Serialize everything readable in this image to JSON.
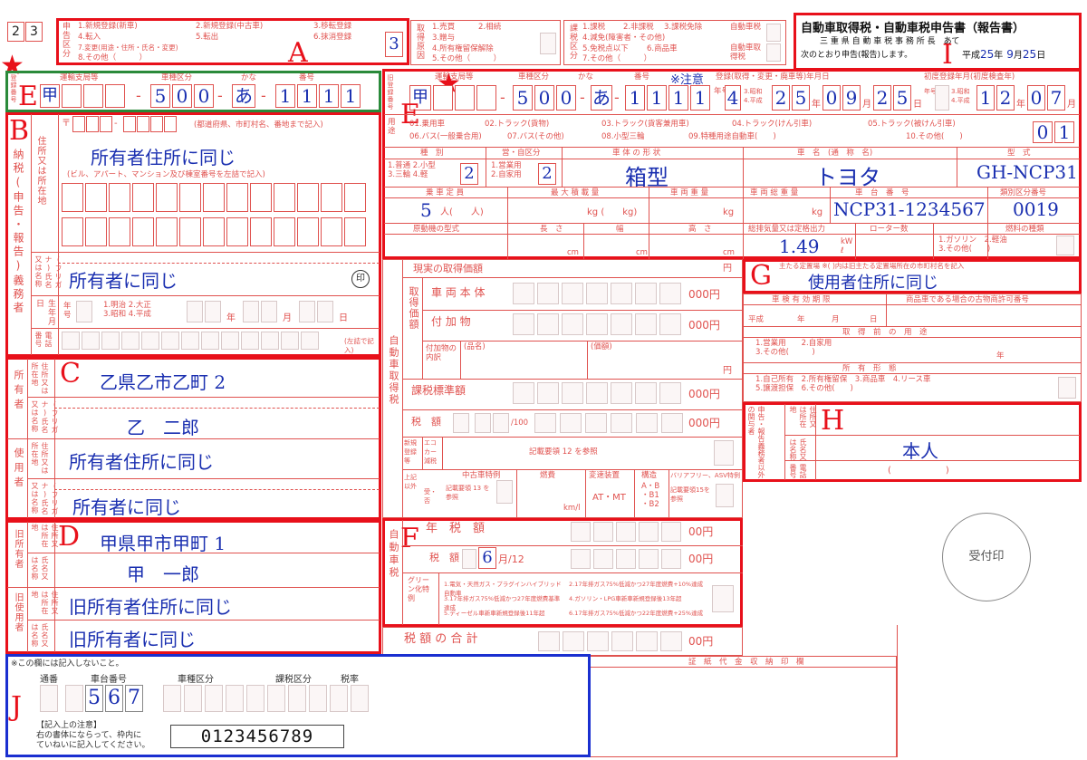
{
  "form_number": [
    "2",
    "3"
  ],
  "title": {
    "main": "自動車取得税・自動車税申告書（報告書）",
    "addressee": "三 重 県 自 動 車 税 事 務 所 長　あて",
    "declare_prefix": "次のとおり申告(報告)します。",
    "era": "平成",
    "year": "25",
    "month": "9",
    "day": "25",
    "y_label": "年",
    "m_label": "月",
    "d_label": "日"
  },
  "section_a": {
    "label": "申告区分",
    "options": [
      "1.新規登録(新車)",
      "2.新規登録(中古車)",
      "3.移転登録",
      "4.転入",
      "5.転出",
      "6.抹消登録",
      "7.変更(用途・住所・氏名・変更)",
      "8.その他（　　　）"
    ],
    "value": "3"
  },
  "section_reason": {
    "label": "取得原因",
    "options": [
      "1.売買",
      "2.相続",
      "3.贈与",
      "4.所有権留保解除",
      "5.その他（　　　）"
    ]
  },
  "section_tax_div": {
    "label": "課税区分",
    "options": [
      "1.課税",
      "2.非課税",
      "3.課税免除",
      "4.減免(障害者・その他)",
      "5.免税点以下",
      "6.商品車",
      "7.その他（　　　）"
    ],
    "right_labels": [
      "自動車税",
      "自動車取得税"
    ]
  },
  "letters": {
    "a": "A",
    "b": "B",
    "c": "C",
    "d": "D",
    "e1": "E",
    "e2": "E",
    "f": "F",
    "g": "G",
    "h": "H",
    "i": "I",
    "j": "J"
  },
  "stars": [
    "★",
    "★"
  ],
  "plate_top": {
    "headers": [
      "運輸支局等",
      "車種区分",
      "かな",
      "番号"
    ],
    "bureau": "甲",
    "class_no": [
      "5",
      "0",
      "0"
    ],
    "kana": "あ",
    "number": [
      "1",
      "1",
      "1",
      "1"
    ],
    "side_label": "登録番号"
  },
  "plate_right": {
    "side_label": "旧登録番号",
    "headers": [
      "運輸支局等",
      "車種区分",
      "かな",
      "番号",
      "登録(取得・変更・廃車等)年月日",
      "初度登録年月(初度検査年)"
    ],
    "note": "※注意",
    "bureau": "甲",
    "class_no": [
      "5",
      "0",
      "0"
    ],
    "kana": "あ",
    "number": [
      "1",
      "1",
      "1",
      "1"
    ],
    "era_code": "4",
    "era_opts": "3.昭和 4.平成",
    "reg_date": [
      "2",
      "5",
      "0",
      "9",
      "2",
      "5"
    ],
    "first_reg": [
      "1",
      "2",
      "0",
      "7"
    ],
    "y_label": "年号",
    "date_units": [
      "年",
      "月",
      "日"
    ],
    "first_units": [
      "年",
      "月"
    ]
  },
  "usage": {
    "label": "用途",
    "options": [
      "01.乗用車",
      "02.トラック(貨物)",
      "03.トラック(貨客兼用車)",
      "04.トラック(けん引車)",
      "05.トラック(被けん引車)",
      "06.バス(一般乗合用)",
      "07.バス(その他)",
      "08.小型三輪",
      "09.特種用途自動車(　　)",
      "10.その他(　　)"
    ],
    "value": [
      "0",
      "1"
    ]
  },
  "vehicle": {
    "h_kind": "種　別",
    "h_business": "営・自区分",
    "h_shape": "車 体 の 形 状",
    "h_name": "車　名　(通　称　名)",
    "h_model": "型　式",
    "kind_opts": "1.普通 2.小型\n3.三輪 4.軽",
    "kind_val": "2",
    "biz_opts": "1.営業用\n2.自家用",
    "biz_val": "2",
    "shape": "箱型",
    "name": "トヨタ",
    "model": "GH-NCP31",
    "h_capacity": "乗 車 定 員",
    "h_load": "最 大 積 載 量",
    "h_weight": "車 両 重 量",
    "h_total": "車 両 総 重 量",
    "h_chassis": "車　台　番　号",
    "h_class_no": "類別区分番号",
    "capacity": "5",
    "cap_unit": "人(　　人)",
    "load_unit": "kg (　　kg)",
    "weight_unit": "kg",
    "total_unit": "kg",
    "chassis": "NCP31-1234567",
    "class_no": "0019",
    "h_engine": "原動機の型式",
    "h_len": "長　さ",
    "h_wid": "幅",
    "h_hei": "高　さ",
    "cm": "cm",
    "h_displacement": "総排気量又は定格出力",
    "h_rotor": "ローター数",
    "h_fuel": "燃料の種類",
    "displacement": "1.49",
    "disp_unit": "kW\nℓ",
    "fuel_opts": "1.ガソリン　2.軽油\n3.その他(　　)"
  },
  "section_b": {
    "vertical_label": "納税(申告・報告)義務者",
    "addr_label": "住所又は所在地",
    "postal_prefix": "〒",
    "postal_note": "(都道府県、市町村名、番地まで記入)",
    "address": "所有者住所に同じ",
    "bldg_note": "(ビル、アパート、マンション及び棟室番号を左詰で記入)",
    "name_label": "(フリガナ)氏名又は名称",
    "name": "所有者に同じ",
    "seal": "印",
    "birth_label": "生年月日",
    "era_label": "年号",
    "era_opts": "1.明治 2.大正\n3.昭和 4.平成",
    "birth_units": [
      "年",
      "月",
      "日"
    ],
    "phone_label": "電話番号",
    "phone_note": "(左詰で記入)"
  },
  "section_c": {
    "owner_label": "所有者",
    "user_label": "使用者",
    "addr_label": "住所又は所在地",
    "name_label": "(フリガナ)氏名又は名称",
    "owner_address": "乙県乙市乙町 2",
    "owner_name": "乙　二郎",
    "user_address": "所有者住所に同じ",
    "user_name": "所有者に同じ"
  },
  "section_d": {
    "old_owner_label": "旧所有者",
    "old_user_label": "旧使用者",
    "addr_label": "住所又は所在地",
    "name_label": "氏名又は名称",
    "old_owner_address": "甲県甲市甲町 1",
    "old_owner_name": "甲　一郎",
    "old_user_address": "旧所有者住所に同じ",
    "old_user_name": "旧所有者に同じ"
  },
  "acq_tax": {
    "side_label": "自動車取得税",
    "actual_price": "現実の取得価額",
    "yen": "円",
    "sub_label": "取得価額",
    "body_price": "車 両 本 体",
    "accessory": "付 加 物",
    "thousand": "000円",
    "acc_detail": "付加物の内訳",
    "acc_name": "(品名)",
    "acc_amount": "(価額)",
    "standard": "課税標準額",
    "tax_amount": "税　額",
    "per100": "/100",
    "new_reg_label": "新規登録等",
    "eco_label": "エコカー減税",
    "note12": "記載要領 12 を参照",
    "special_label": "上記以外",
    "used_special": "中古車特例",
    "recv_deny": "受・否",
    "note13": "記載要領 13 を参照",
    "fuel_eff": "燃費",
    "kml": "km/l",
    "transmission": "変速装置",
    "at_mt": "AT・MT",
    "structure": "構造",
    "abb": "A・B\n・B1\n・B2",
    "barrier": "バリアフリー、ASV特例",
    "note15": "記載要領15を参照"
  },
  "car_tax": {
    "side_label": "自動車税",
    "annual": "年　税　額",
    "tax_amt": "税　額",
    "months": "6",
    "per12": "月/12",
    "green_label": "グリーン化特例",
    "green_opts": [
      "1.電気・天然ガス・プラグインハイブリッド自動車",
      "2.17年排ガス75%低減かつ27年度燃費+10%達成",
      "3.17年排ガス75%低減かつ27年度燃費基準達成",
      "4.ガソリン・LPG車新車新規登録後13年超",
      "5.ディーゼル車新車新規登録後11年超",
      "6.17年排ガス75%低減かつ22年度燃費+25%達成"
    ],
    "total": "税 額 の 合 計",
    "thousand": "00円"
  },
  "section_g": {
    "header": "主たる定置場 ※( )内は旧主たる定置場所在の市町村名を記入",
    "value": "使用者住所に同じ",
    "inspection": "車 検 有 効 期 限",
    "dealer_no": "商品車である場合の古物商許可番号",
    "era": "平成",
    "ymd": [
      "年",
      "月",
      "日"
    ],
    "prev_use": "取　得　前　の　用　途",
    "prev_opts": "1.営業用　　2.自家用\n3.その他(　　　)",
    "year": "年",
    "ownership": "所　有　形　態",
    "own_opts": "1.自己所有　2.所有権留保　3.商品車　4.リース車\n5.譲渡担保　6.その他(　　)"
  },
  "section_h": {
    "vertical_label": "申告・報告義務者以外の関与者",
    "addr_label": "住所又は所在地",
    "name_label": "氏名又は名称",
    "phone_label": "電話番号",
    "name": "本人",
    "phone_paren": "(　　　　　　)"
  },
  "section_j": {
    "note": "※この欄には記入しないこと。",
    "headers": [
      "通番",
      "車台番号",
      "車種区分",
      "課税区分",
      "税率"
    ],
    "digits": [
      "5",
      "6",
      "7"
    ],
    "writing_note": "【記入上の注意】\n右の書体にならって、枠内に\nていねいに記入してください。",
    "sample": "0123456789"
  },
  "stamp_area": {
    "header": "証　紙　代　金　収　納　印　欄",
    "stamp": "受付印"
  }
}
